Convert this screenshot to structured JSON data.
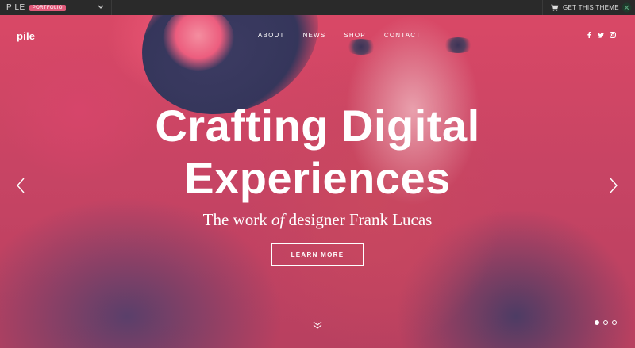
{
  "topbar": {
    "brand": "PILE",
    "badge": "PORTFOLIO",
    "get_theme": "GET THIS THEME"
  },
  "site": {
    "logo": "pile",
    "nav": [
      "ABOUT",
      "NEWS",
      "SHOP",
      "CONTACT"
    ],
    "social": [
      "facebook-icon",
      "twitter-icon",
      "instagram-icon"
    ]
  },
  "hero": {
    "title_line1": "Crafting Digital",
    "title_line2": "Experiences",
    "subtitle_pre": "The work ",
    "subtitle_em": "of",
    "subtitle_post": " designer Frank Lucas",
    "button": "LEARN MORE"
  },
  "slider": {
    "slides": 3,
    "active_index": 0
  },
  "colors": {
    "accent": "#e05a7a",
    "hero_tint": "#d94866",
    "topbar_bg": "#2a2a2a"
  }
}
